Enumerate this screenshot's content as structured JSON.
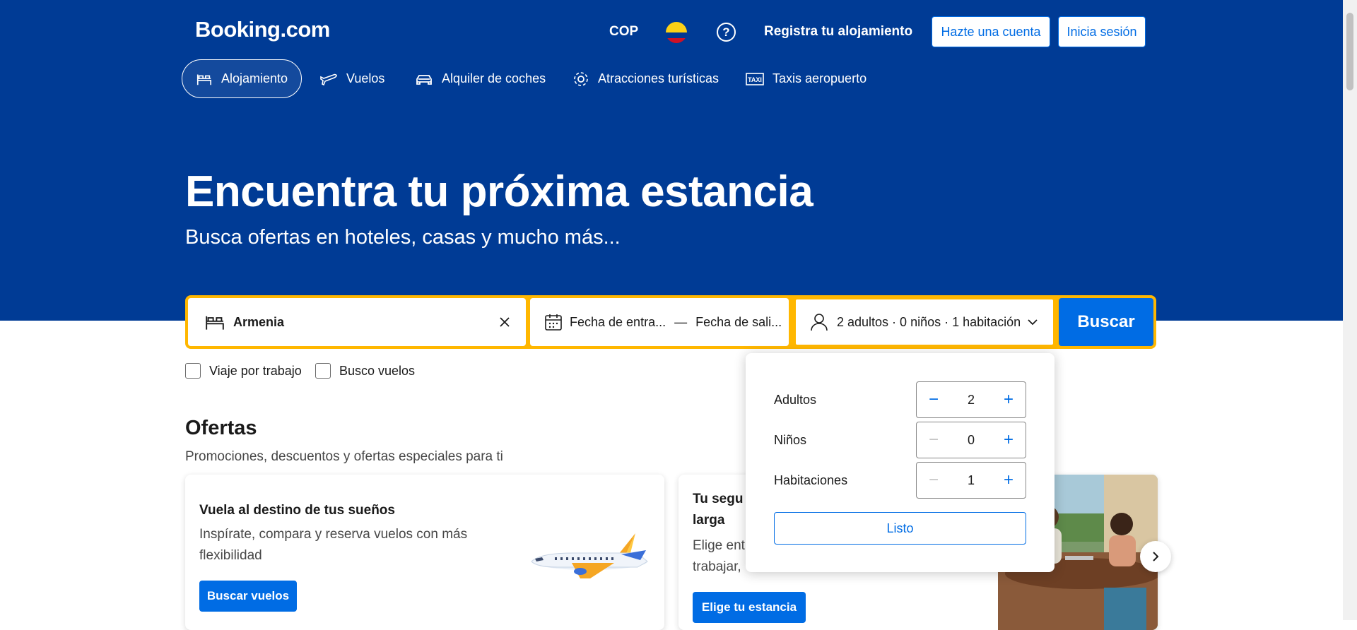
{
  "header": {
    "logo": "Booking.com",
    "currency": "COP",
    "register_property": "Registra tu alojamiento",
    "signup_button": "Hazte una cuenta",
    "signin_button": "Inicia sesión"
  },
  "nav": [
    {
      "label": "Alojamiento",
      "icon": "bed-icon",
      "active": true
    },
    {
      "label": "Vuelos",
      "icon": "plane-icon"
    },
    {
      "label": "Alquiler de coches",
      "icon": "car-icon"
    },
    {
      "label": "Atracciones turísticas",
      "icon": "attractions-icon"
    },
    {
      "label": "Taxis aeropuerto",
      "icon": "taxi-icon"
    }
  ],
  "hero": {
    "title": "Encuentra tu próxima estancia",
    "subtitle": "Busca ofertas en hoteles, casas y mucho más..."
  },
  "search": {
    "destination": "Armenia",
    "checkin": "Fecha de entra...",
    "separator": "—",
    "checkout": "Fecha de sali...",
    "occupancy": "2 adultos · 0 niños · 1 habitación",
    "button": "Buscar"
  },
  "checkboxes": {
    "work_trip": "Viaje por trabajo",
    "flights": "Busco vuelos"
  },
  "occupancy_popup": {
    "rows": [
      {
        "label": "Adultos",
        "value": "2"
      },
      {
        "label": "Niños",
        "value": "0"
      },
      {
        "label": "Habitaciones",
        "value": "1"
      }
    ],
    "done_button": "Listo"
  },
  "offers": {
    "title": "Ofertas",
    "subtitle": "Promociones, descuentos y ofertas especiales para ti",
    "cards": [
      {
        "heading": "Vuela al destino de tus sueños",
        "body_line1": "Inspírate, compara y reserva vuelos con más",
        "body_line2": "flexibilidad",
        "button": "Buscar vuelos"
      },
      {
        "heading_line1": "Tu segu",
        "heading_line2": "larga",
        "body_line1": "Elige ent",
        "body_line2": "trabajar, ",
        "button": "Elige tu estancia"
      }
    ]
  },
  "colors": {
    "brand_blue": "#003b95",
    "action_blue": "#006ce4",
    "search_border": "#ffb700"
  }
}
